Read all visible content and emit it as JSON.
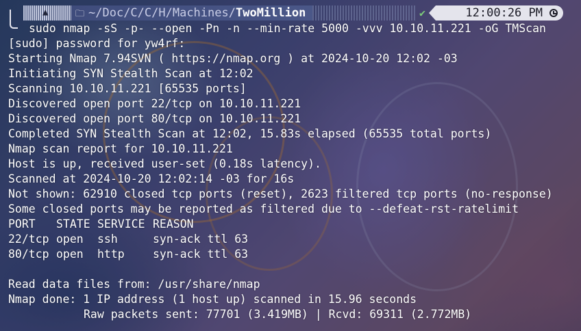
{
  "prompt": {
    "os_icon": "arch-linux-icon",
    "folder_icon": "folder-icon",
    "path_prefix": "~/Doc/C/C/H/",
    "path_sep_1": "Machines",
    "path_sep_2": "/",
    "path_last": "TwoMillion",
    "status_icon": "check-icon",
    "time": "12:00:26 PM",
    "clock_icon": "clock-icon"
  },
  "terminal": {
    "command": "sudo nmap -sS -p- --open -Pn -n --min-rate 5000 -vvv 10.10.11.221 -oG TMScan",
    "lines_before_table": [
      "[sudo] password for yw4rf:",
      "Starting Nmap 7.94SVN ( https://nmap.org ) at 2024-10-20 12:02 -03",
      "Initiating SYN Stealth Scan at 12:02",
      "Scanning 10.10.11.221 [65535 ports]",
      "Discovered open port 22/tcp on 10.10.11.221",
      "Discovered open port 80/tcp on 10.10.11.221",
      "Completed SYN Stealth Scan at 12:02, 15.83s elapsed (65535 total ports)",
      "Nmap scan report for 10.10.11.221",
      "Host is up, received user-set (0.18s latency).",
      "Scanned at 2024-10-20 12:02:14 -03 for 16s",
      "Not shown: 62910 closed tcp ports (reset), 2623 filtered tcp ports (no-response)",
      "Some closed ports may be reported as filtered due to --defeat-rst-ratelimit"
    ],
    "table": {
      "headers": [
        "PORT",
        "STATE",
        "SERVICE",
        "REASON"
      ],
      "rows": [
        [
          "22/tcp",
          "open",
          "ssh",
          "syn-ack ttl 63"
        ],
        [
          "80/tcp",
          "open",
          "http",
          "syn-ack ttl 63"
        ]
      ]
    },
    "lines_after_table": [
      "Read data files from: /usr/share/nmap",
      "Nmap done: 1 IP address (1 host up) scanned in 15.96 seconds"
    ],
    "raw_packets": "Raw packets sent: 77701 (3.419MB) | Rcvd: 69311 (2.772MB)"
  },
  "colors": {
    "text": "#ffffff",
    "path_bar": "#4a5788",
    "clock_bar": "#e4e4ec",
    "status_ok": "#7fd07a"
  }
}
